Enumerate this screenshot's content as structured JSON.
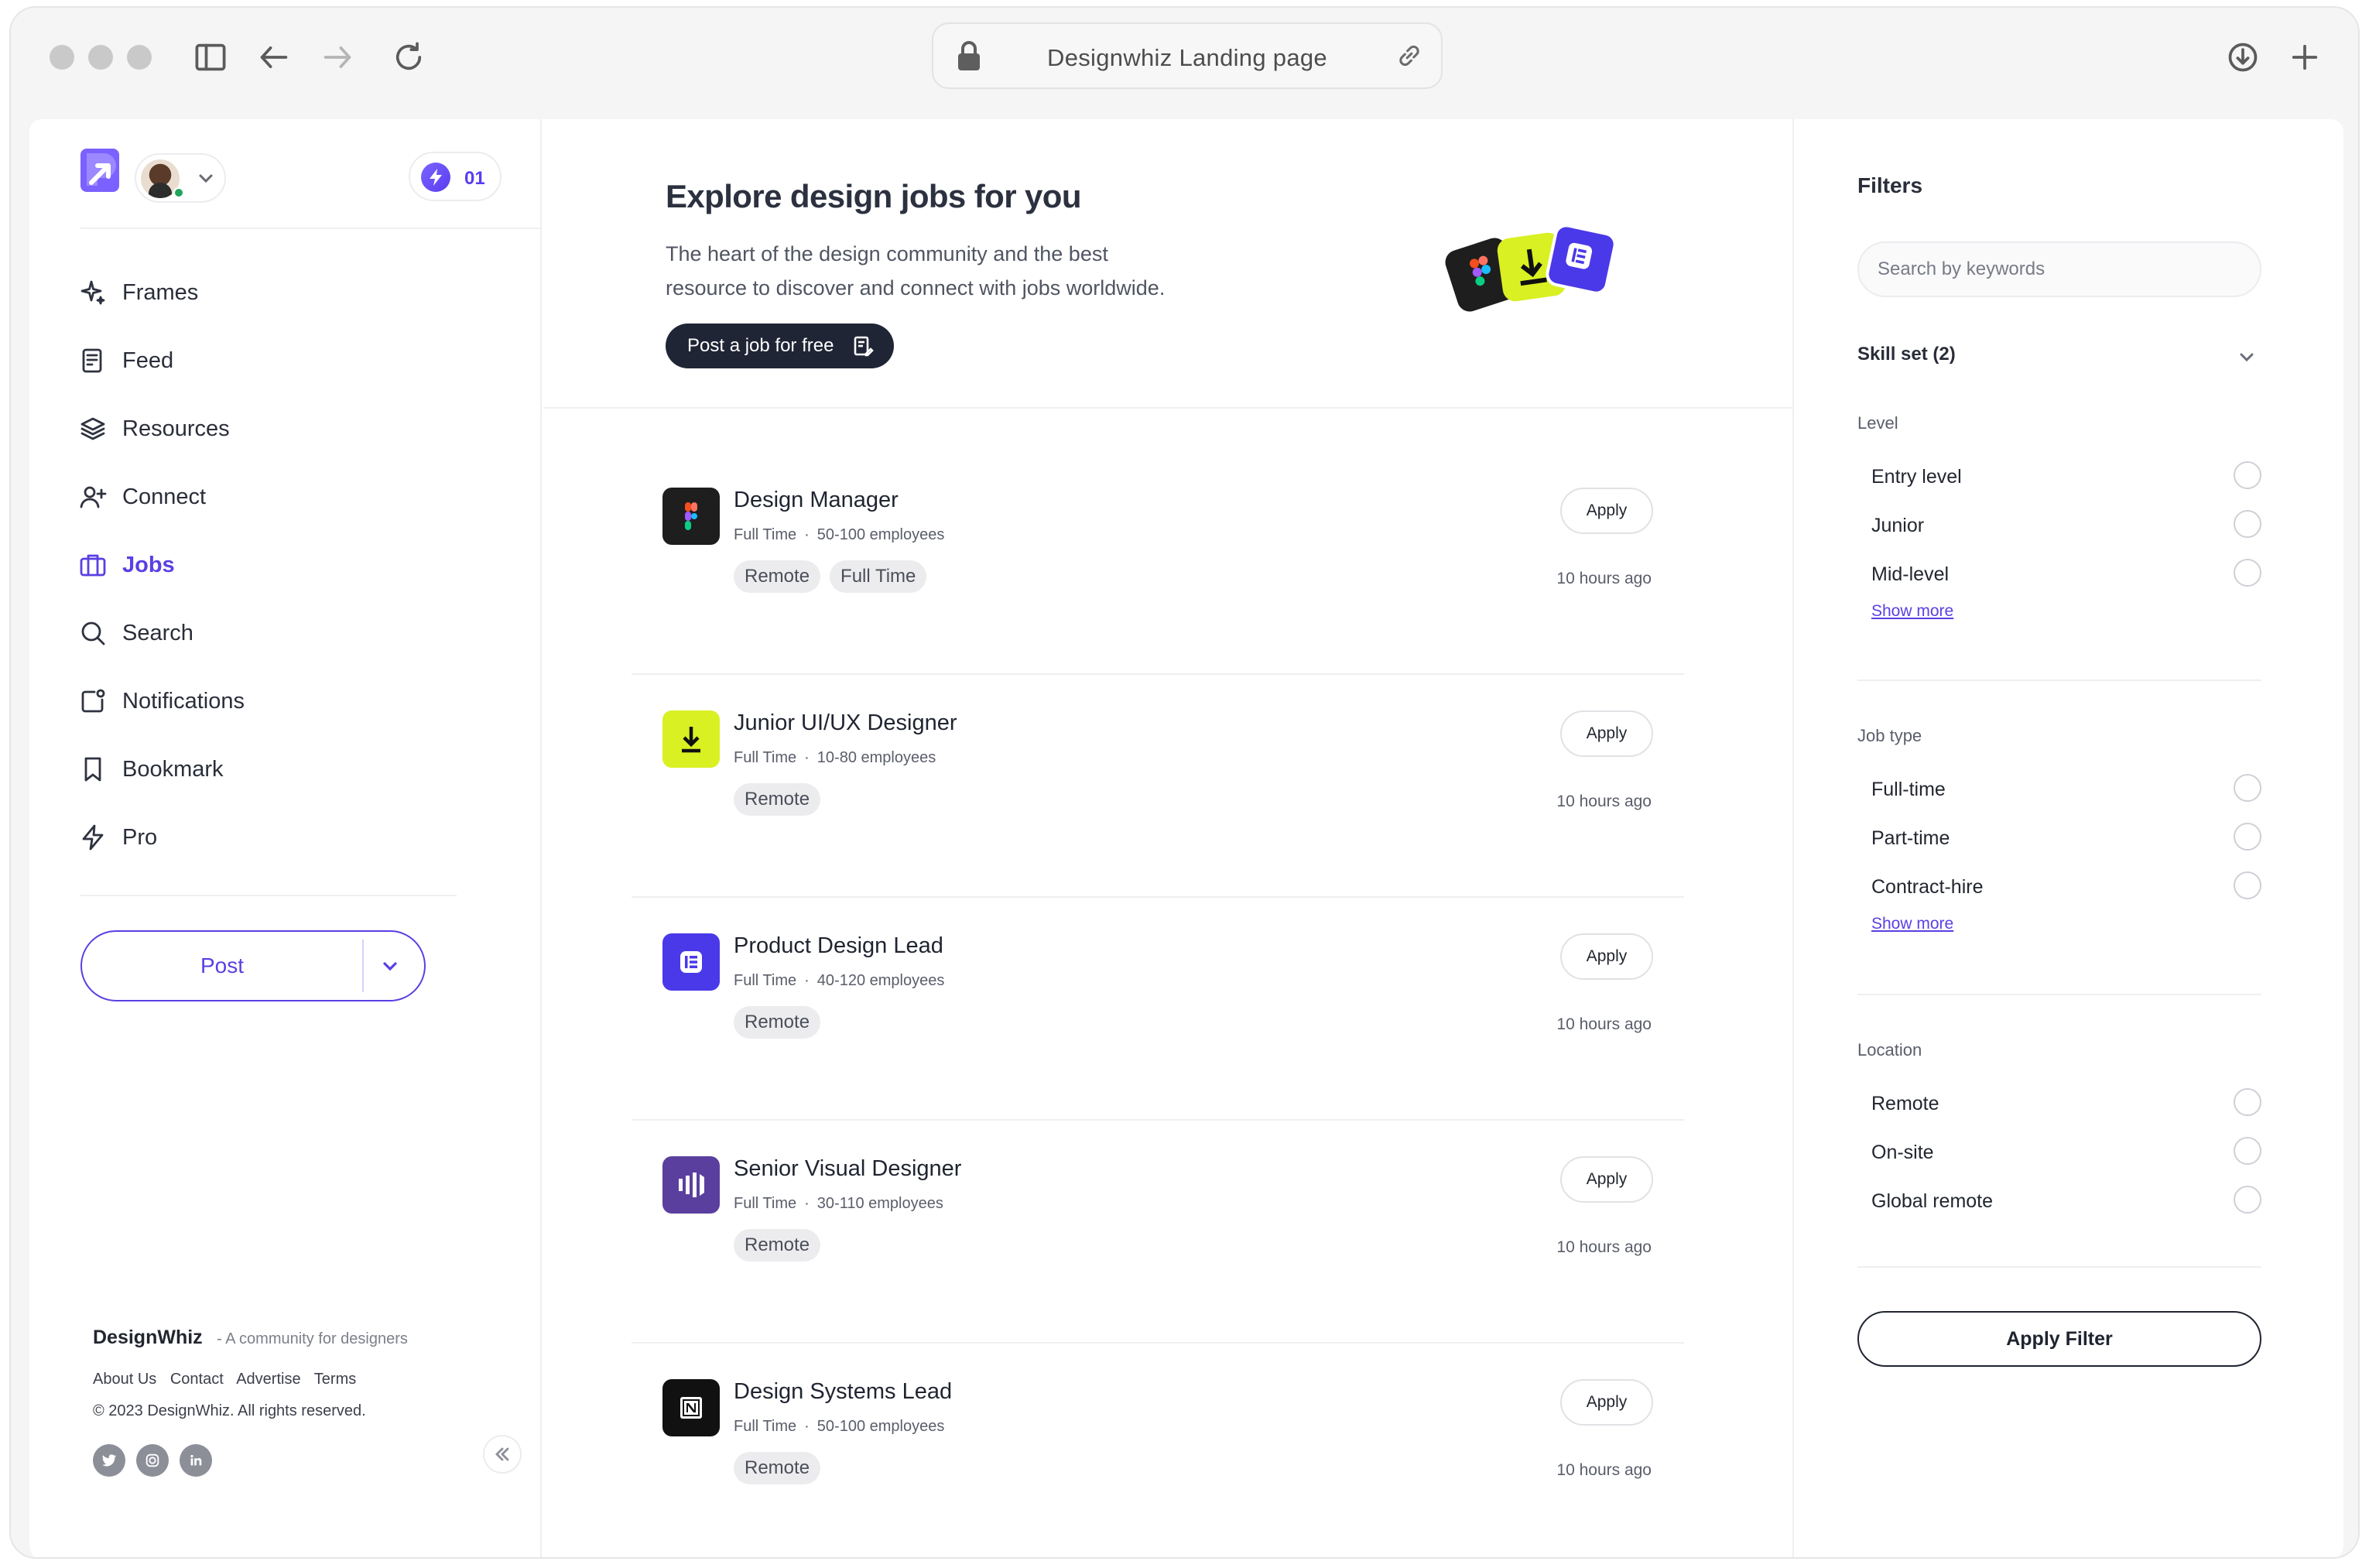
{
  "browser": {
    "tab_title": "Designwhiz Landing page"
  },
  "sidebar": {
    "credits": "01",
    "items": [
      {
        "label": "Frames",
        "icon": "sparkle-icon",
        "active": false
      },
      {
        "label": "Feed",
        "icon": "feed-icon",
        "active": false
      },
      {
        "label": "Resources",
        "icon": "layers-icon",
        "active": false
      },
      {
        "label": "Connect",
        "icon": "add-user-icon",
        "active": false
      },
      {
        "label": "Jobs",
        "icon": "briefcase-icon",
        "active": true
      },
      {
        "label": "Search",
        "icon": "search-icon",
        "active": false
      },
      {
        "label": "Notifications",
        "icon": "notification-icon",
        "active": false
      },
      {
        "label": "Bookmark",
        "icon": "bookmark-icon",
        "active": false
      },
      {
        "label": "Pro",
        "icon": "bolt-icon",
        "active": false
      }
    ],
    "post_label": "Post",
    "footer": {
      "brand": "DesignWhiz",
      "tagline": "-   A community for designers",
      "links": [
        "About Us",
        "Contact",
        "Advertise",
        "Terms"
      ],
      "copyright": "© 2023 DesignWhiz. All rights reserved.",
      "socials": [
        "twitter-icon",
        "instagram-icon",
        "linkedin-icon"
      ]
    }
  },
  "hero": {
    "title": "Explore design jobs for you",
    "subtitle_line1": "The heart of the design community and the best",
    "subtitle_line2": "resource to discover and connect with jobs worldwide.",
    "cta": "Post a job for free"
  },
  "jobs": [
    {
      "title": "Design Manager",
      "type": "Full Time",
      "size": "50-100 employees",
      "tags": [
        "Remote",
        "Full Time"
      ],
      "ago": "10 hours ago",
      "apply": "Apply",
      "logo": "figma-logo",
      "logo_bg": "#1e1e1e"
    },
    {
      "title": "Junior UI/UX Designer",
      "type": "Full Time",
      "size": "10-80 employees",
      "tags": [
        "Remote"
      ],
      "ago": "10 hours ago",
      "apply": "Apply",
      "logo": "download-logo",
      "logo_bg": "#d9f022"
    },
    {
      "title": "Product Design Lead",
      "type": "Full Time",
      "size": "40-120 employees",
      "tags": [
        "Remote"
      ],
      "ago": "10 hours ago",
      "apply": "Apply",
      "logo": "elementor-logo",
      "logo_bg": "#4a39e8"
    },
    {
      "title": "Senior Visual Designer",
      "type": "Full Time",
      "size": "30-110 employees",
      "tags": [
        "Remote"
      ],
      "ago": "10 hours ago",
      "apply": "Apply",
      "logo": "bars-logo",
      "logo_bg": "#5a3f9e"
    },
    {
      "title": "Design Systems Lead",
      "type": "Full Time",
      "size": "50-100 employees",
      "tags": [
        "Remote"
      ],
      "ago": "10 hours ago",
      "apply": "Apply",
      "logo": "notion-logo",
      "logo_bg": "#111111"
    }
  ],
  "filters": {
    "title": "Filters",
    "search_placeholder": "Search by keywords",
    "skill_set": "Skill set (2)",
    "level": {
      "heading": "Level",
      "options": [
        "Entry level",
        "Junior",
        "Mid-level"
      ],
      "show_more": "Show more"
    },
    "job_type": {
      "heading": "Job type",
      "options": [
        "Full-time",
        "Part-time",
        "Contract-hire"
      ],
      "show_more": "Show more"
    },
    "location": {
      "heading": "Location",
      "options": [
        "Remote",
        "On-site",
        "Global remote"
      ]
    },
    "apply_label": "Apply Filter"
  },
  "colors": {
    "accent": "#5b3fe3",
    "dark": "#1f2535"
  }
}
